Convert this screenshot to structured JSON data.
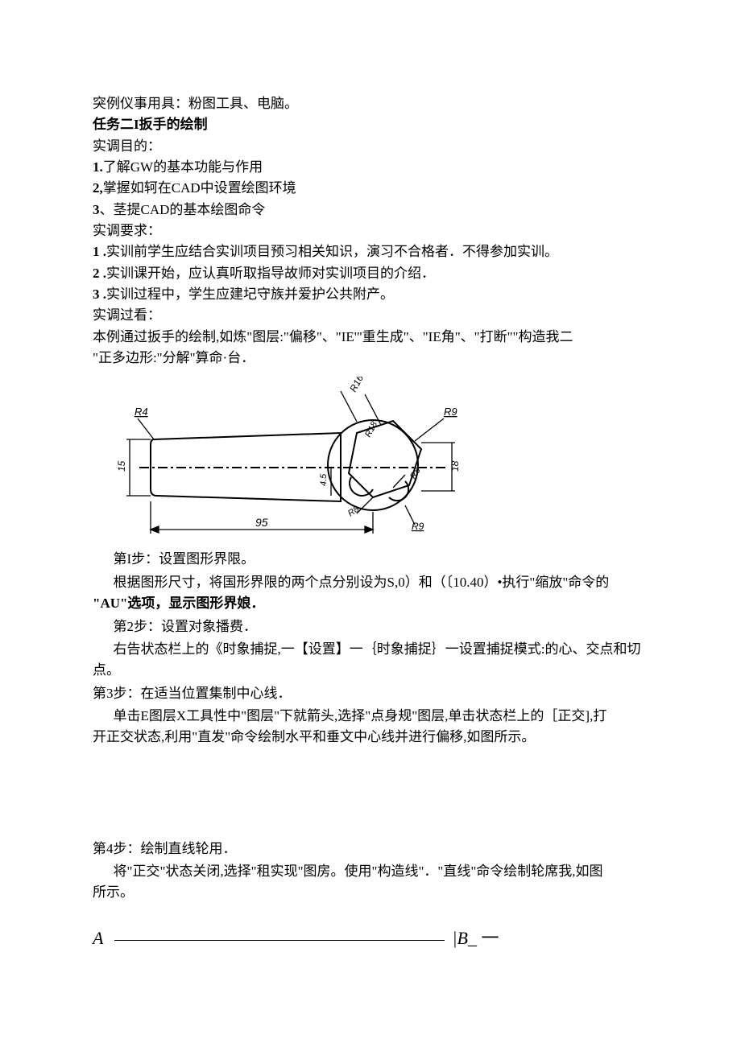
{
  "header": {
    "tools": "突例仪事用具：粉图工具、电脑。",
    "task_title": "任务二I扳手的绘制",
    "aim_title": "实调目的：",
    "aim1": "了解GW的基本功能与作用",
    "aim2": "掌握如轲在CAD中设置绘图环境",
    "aim3": "、茎提CAD的基本绘图命令",
    "req_title": "实调要求：",
    "req1": "实训前学生应结合实训项目预习相关知识，演习不合格者．不得参加实训。",
    "req2": "实训课开始，应认真听取指导故师对实训项目的介绍．",
    "req3": "实训过程中，学生应建圮守族并爱护公共附产。",
    "look_title": "实调过看：",
    "intro_line1": "本例通过扳手的绘制,如炼\"图层:\"偏移\"、\"IE'\"重生成\"、\"IE角\"、\"打断\"\"构造我二",
    "intro_line2": "\"正多边形:\"分解\"算命·台．"
  },
  "diagram_labels": {
    "R4": "R4",
    "R16": "R16",
    "R9a": "R9",
    "R18": "R18",
    "R8a": "R8",
    "R8b": "R8",
    "R9b": "R9",
    "d15": "15",
    "d18": "18",
    "d45": "4.5",
    "d95": "95"
  },
  "steps": {
    "s1_title": "第I步：设置图形界限。",
    "s1_body1": "根据图形尺寸，将国形界限的两个点分别设为S,0）和（〔10.40）•执行\"缩放\"命令的",
    "s1_body2": "\"AU\"选项，显示图形界娘．",
    "s2_title": "第2步：设置对象播费．",
    "s2_body1": "右告状态栏上的《时象捕捉,一【设置】一｛时象捕捉｝一设置捕捉模式:的心、交点和切",
    "s2_body2": "点。",
    "s3_title": "第3步：在适当位置集制中心线．",
    "s3_body1": "单击E图层X工具性中\"图层\"下就箭头,选择\"点身规\"图层,单击状态栏上的［正交],打",
    "s3_body2": "开正交状态,利用\"直发\"命令绘制水平和垂文中心线并进行偏移,如图所示。",
    "s4_title": "第4步：绘制直线轮用．",
    "s4_body1": "将\"正交\"状态关闭,选择\"租实现\"图房。使用\"构造线\"．\"直线\"命令绘制轮席我,如图",
    "s4_body2": "所示。"
  },
  "nums": {
    "one": "1.",
    "two": "2,",
    "three": "3",
    "n1": "1 .",
    "n2": "2 .",
    "n3": "3 ."
  },
  "eq": {
    "A": "A",
    "B": "|B_",
    "dash": "一"
  }
}
